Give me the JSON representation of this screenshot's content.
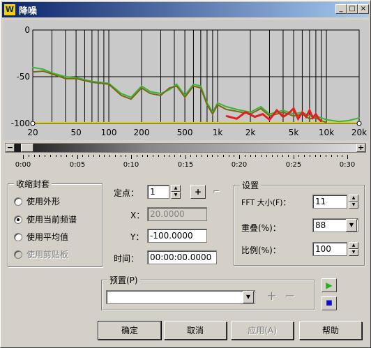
{
  "window": {
    "title": "降噪",
    "icon_letter": "W"
  },
  "titlebar_buttons": [
    "_",
    "□",
    "×"
  ],
  "chart_data": {
    "type": "line",
    "xscale": "log",
    "xlim": [
      20,
      20000
    ],
    "ylim": [
      -100,
      0
    ],
    "x_tick_labels": [
      "20",
      "50",
      "100",
      "200",
      "500",
      "1k",
      "2k",
      "5k",
      "10k",
      "20k"
    ],
    "y_tick_labels": [
      "0",
      "-50",
      "-100"
    ],
    "series": [
      {
        "color": "#3cb43c",
        "x": [
          20,
          25,
          30,
          40,
          50,
          70,
          100,
          130,
          160,
          200,
          240,
          300,
          360,
          420,
          500,
          600,
          700,
          800,
          900,
          1000,
          1200,
          1500,
          2000,
          2500,
          3000,
          4000,
          5000,
          6000,
          7000,
          8000,
          9000,
          10000,
          13000,
          16000,
          20000
        ],
        "y": [
          -40,
          -42,
          -46,
          -50,
          -51,
          -55,
          -57,
          -68,
          -72,
          -60,
          -66,
          -68,
          -64,
          -58,
          -70,
          -58,
          -60,
          -78,
          -88,
          -78,
          -82,
          -85,
          -88,
          -82,
          -90,
          -86,
          -90,
          -88,
          -92,
          -92,
          -94,
          -96,
          -98,
          -97,
          -94
        ]
      },
      {
        "color": "#7a6a10",
        "x": [
          20,
          25,
          30,
          40,
          50,
          70,
          100,
          130,
          160,
          200,
          240,
          300,
          360,
          420,
          500,
          600,
          700,
          800,
          900,
          1000,
          1200,
          1500,
          2000,
          2500,
          3000,
          4000,
          5000,
          6000,
          7000,
          8000,
          9000,
          10000
        ],
        "y": [
          -45,
          -44,
          -47,
          -52,
          -52,
          -56,
          -58,
          -70,
          -74,
          -62,
          -68,
          -70,
          -62,
          -60,
          -72,
          -60,
          -62,
          -80,
          -90,
          -80,
          -85,
          -87,
          -90,
          -84,
          -92,
          -88,
          -92,
          -90,
          -95,
          -94,
          -97,
          -99
        ]
      },
      {
        "color": "#e02020",
        "x": [
          1200,
          1500,
          1800,
          2200,
          2600,
          3000,
          3500,
          4000,
          4500,
          5000,
          5500,
          6000,
          6500,
          7000,
          7500,
          8000,
          8500,
          9000
        ],
        "y": [
          -92,
          -95,
          -88,
          -93,
          -90,
          -96,
          -86,
          -93,
          -89,
          -84,
          -95,
          -88,
          -93,
          -86,
          -94,
          -90,
          -95,
          -98
        ]
      }
    ],
    "floor_line": {
      "y": -100,
      "color": "#e0d000"
    }
  },
  "scrollbar": {
    "left_label": "−",
    "right_label": "+"
  },
  "ruler_labels": [
    "0:00",
    "0:05",
    "0:10",
    "0:15",
    "0:20",
    "0:25",
    "0:30"
  ],
  "envelope": {
    "title": "收缩封套",
    "options": [
      {
        "label": "使用外形",
        "selected": false,
        "disabled": false
      },
      {
        "label": "使用当前频谱",
        "selected": true,
        "disabled": false
      },
      {
        "label": "使用平均值",
        "selected": false,
        "disabled": false
      },
      {
        "label": "使用剪贴板",
        "selected": false,
        "disabled": true
      }
    ]
  },
  "point": {
    "label": "定点：",
    "value": "1",
    "x_label": "X：",
    "x_value": "20.0000",
    "y_label": "Y：",
    "y_value": "-100.0000",
    "time_label": "时间：",
    "time_value": "00:00:00.0000"
  },
  "settings": {
    "title": "设置",
    "fft_label": "FFT 大小(F)：",
    "fft_value": "11",
    "overlap_label": "重叠(%)：",
    "overlap_value": "88",
    "ratio_label": "比例(%)：",
    "ratio_value": "100"
  },
  "preset": {
    "title": "预置(P)",
    "value": ""
  },
  "buttons": {
    "ok": "确定",
    "cancel": "取消",
    "apply": "应用(A)",
    "help": "帮助"
  }
}
